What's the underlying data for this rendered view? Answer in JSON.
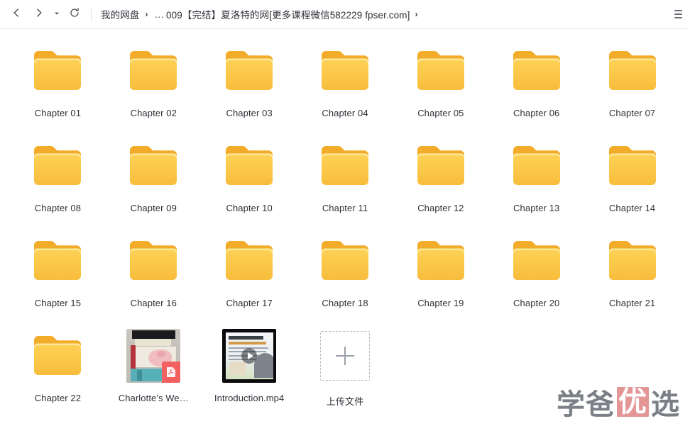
{
  "window": {
    "title": "我的网盘 - 009【完结】夏洛特的网"
  },
  "toolbar": {
    "back_icon": "chevron-left-icon",
    "forward_icon": "chevron-right-icon",
    "history_caret_icon": "caret-down-icon",
    "refresh_icon": "refresh-icon",
    "menu_icon": "hamburger-menu-icon",
    "breadcrumb": {
      "root": "我的网盘",
      "separator": "›",
      "ellipsis": "…",
      "current": "009【完结】夏洛特的网[更多课程微信582229 fpser.com]",
      "tail_separator": "›"
    }
  },
  "files": [
    {
      "name": "Chapter 01",
      "type": "folder"
    },
    {
      "name": "Chapter 02",
      "type": "folder"
    },
    {
      "name": "Chapter 03",
      "type": "folder"
    },
    {
      "name": "Chapter 04",
      "type": "folder"
    },
    {
      "name": "Chapter 05",
      "type": "folder"
    },
    {
      "name": "Chapter 06",
      "type": "folder"
    },
    {
      "name": "Chapter 07",
      "type": "folder"
    },
    {
      "name": "Chapter 08",
      "type": "folder"
    },
    {
      "name": "Chapter 09",
      "type": "folder"
    },
    {
      "name": "Chapter 10",
      "type": "folder"
    },
    {
      "name": "Chapter 11",
      "type": "folder"
    },
    {
      "name": "Chapter 12",
      "type": "folder"
    },
    {
      "name": "Chapter 13",
      "type": "folder"
    },
    {
      "name": "Chapter 14",
      "type": "folder"
    },
    {
      "name": "Chapter 15",
      "type": "folder"
    },
    {
      "name": "Chapter 16",
      "type": "folder"
    },
    {
      "name": "Chapter 17",
      "type": "folder"
    },
    {
      "name": "Chapter 18",
      "type": "folder"
    },
    {
      "name": "Chapter 19",
      "type": "folder"
    },
    {
      "name": "Chapter 20",
      "type": "folder"
    },
    {
      "name": "Chapter 21",
      "type": "folder"
    },
    {
      "name": "Chapter 22",
      "type": "folder"
    },
    {
      "name": "Charlotte's We…",
      "type": "pdf"
    },
    {
      "name": "Introduction.mp4",
      "type": "video"
    }
  ],
  "upload": {
    "label": "上传文件",
    "icon": "plus-icon"
  },
  "watermark": {
    "part1": "学爸",
    "stamp": "优",
    "part2": "选"
  },
  "colors": {
    "folder_tab": "#f3ac2a",
    "folder_body_top": "#fdd155",
    "folder_body_bottom": "#f8bd3c",
    "folder_flap": "#fde79a",
    "pdf_badge": "#f2615f",
    "watermark_text": "#6f767c",
    "watermark_stamp": "#e28e8e",
    "label_text": "#2d3138",
    "toolbar_border": "#ededef"
  }
}
